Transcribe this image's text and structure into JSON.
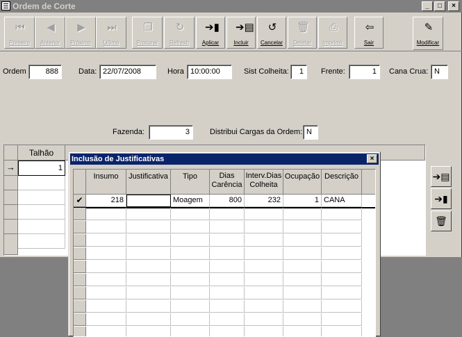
{
  "window": {
    "title": "Ordem de Corte",
    "min": "_",
    "max": "□",
    "close": "×"
  },
  "toolbar": [
    {
      "label": "Primeiro",
      "glyph": "⏮",
      "enabled": false,
      "name": "first-button",
      "icon": "first-record-icon"
    },
    {
      "label": "Anterior",
      "glyph": "◀",
      "enabled": false,
      "name": "previous-button",
      "icon": "previous-record-icon"
    },
    {
      "label": "Próximo",
      "glyph": "▶",
      "enabled": false,
      "name": "next-button",
      "icon": "next-record-icon"
    },
    {
      "label": "Último",
      "glyph": "⏭",
      "enabled": false,
      "name": "last-button",
      "icon": "last-record-icon"
    },
    {
      "label": "Procurar",
      "glyph": "❐",
      "enabled": false,
      "name": "search-button",
      "icon": "search-icon"
    },
    {
      "label": "Refresh",
      "glyph": "↻",
      "enabled": false,
      "name": "refresh-button",
      "icon": "refresh-icon"
    },
    {
      "label": "Aplicar",
      "glyph": "➔▮",
      "enabled": true,
      "name": "apply-button",
      "icon": "apply-icon"
    },
    {
      "label": "Incluir",
      "glyph": "➔▤",
      "enabled": true,
      "name": "include-button",
      "icon": "insert-icon"
    },
    {
      "label": "Cancelar",
      "glyph": "↺",
      "enabled": true,
      "name": "cancel-button",
      "icon": "undo-icon"
    },
    {
      "label": "Deletar",
      "glyph": "🗑",
      "enabled": false,
      "name": "delete-button",
      "icon": "trash-icon"
    },
    {
      "label": "Imprimir",
      "glyph": "⎙",
      "enabled": false,
      "name": "print-button",
      "icon": "printer-icon"
    },
    {
      "label": "Sair",
      "glyph": "⇦",
      "enabled": true,
      "name": "exit-button",
      "icon": "exit-door-icon"
    },
    {
      "label": "Modificar",
      "glyph": "✎",
      "enabled": true,
      "name": "modify-button",
      "icon": "edit-icon"
    }
  ],
  "form": {
    "ordem_label": "Ordem",
    "ordem": "888",
    "data_label": "Data:",
    "data": "22/07/2008",
    "hora_label": "Hora",
    "hora": "10:00:00",
    "sist_label": "Sist Colheita:",
    "sist": "1",
    "frente_label": "Frente:",
    "frente": "1",
    "cana_label": "Cana Crua:",
    "cana": "N",
    "fazenda_label": "Fazenda:",
    "fazenda": "3",
    "distribui_label": "Distribui Cargas da Ordem:",
    "distribui": "N"
  },
  "main_grid": {
    "header": "Talhão",
    "row_indicator": "→",
    "talhao": "1"
  },
  "side_buttons": [
    {
      "glyph": "➔▤",
      "name": "side-insert-button",
      "icon": "insert-icon"
    },
    {
      "glyph": "➔▮",
      "name": "side-apply-button",
      "icon": "apply-icon"
    },
    {
      "glyph": "🗑",
      "name": "side-delete-button",
      "icon": "trash-icon"
    }
  ],
  "dialog": {
    "title": "Inclusão de Justificativas",
    "close": "×",
    "columns": [
      "Insumo",
      "Justificativa",
      "Tipo",
      "Dias\nCarência",
      "Interv.Dias\nColheita",
      "Ocupação",
      "Descrição"
    ],
    "row_indicator": "✔",
    "rows": [
      [
        "218",
        "",
        "Moagem",
        "800",
        "232",
        "1",
        "CANA"
      ]
    ]
  }
}
